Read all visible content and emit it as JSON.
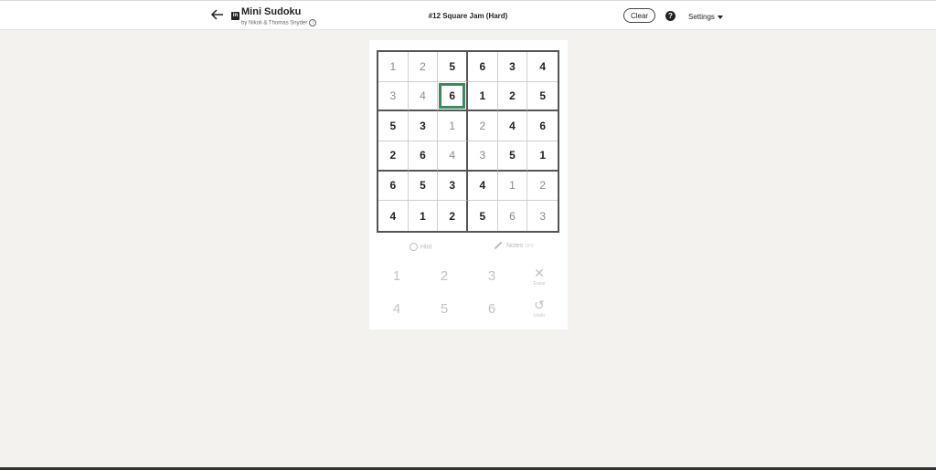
{
  "header": {
    "app_title": "Mini Sudoku",
    "byline": "by Nikoli & Thomas Snyder",
    "linkedin_badge": "in",
    "puzzle_title": "#12 Square Jam (Hard)",
    "clear_label": "Clear",
    "help_label": "?",
    "settings_label": "Settings"
  },
  "board": {
    "rows": [
      [
        {
          "v": "1",
          "t": "entered"
        },
        {
          "v": "2",
          "t": "entered"
        },
        {
          "v": "5",
          "t": "given"
        },
        {
          "v": "6",
          "t": "given"
        },
        {
          "v": "3",
          "t": "given"
        },
        {
          "v": "4",
          "t": "given"
        }
      ],
      [
        {
          "v": "3",
          "t": "entered"
        },
        {
          "v": "4",
          "t": "entered"
        },
        {
          "v": "6",
          "t": "given",
          "selected": true
        },
        {
          "v": "1",
          "t": "given"
        },
        {
          "v": "2",
          "t": "given"
        },
        {
          "v": "5",
          "t": "given"
        }
      ],
      [
        {
          "v": "5",
          "t": "given"
        },
        {
          "v": "3",
          "t": "given"
        },
        {
          "v": "1",
          "t": "entered"
        },
        {
          "v": "2",
          "t": "entered"
        },
        {
          "v": "4",
          "t": "given"
        },
        {
          "v": "6",
          "t": "given"
        }
      ],
      [
        {
          "v": "2",
          "t": "given"
        },
        {
          "v": "6",
          "t": "given"
        },
        {
          "v": "4",
          "t": "entered"
        },
        {
          "v": "3",
          "t": "entered"
        },
        {
          "v": "5",
          "t": "given"
        },
        {
          "v": "1",
          "t": "given"
        }
      ],
      [
        {
          "v": "6",
          "t": "given"
        },
        {
          "v": "5",
          "t": "given"
        },
        {
          "v": "3",
          "t": "given"
        },
        {
          "v": "4",
          "t": "given"
        },
        {
          "v": "1",
          "t": "entered"
        },
        {
          "v": "2",
          "t": "entered"
        }
      ],
      [
        {
          "v": "4",
          "t": "given"
        },
        {
          "v": "1",
          "t": "given"
        },
        {
          "v": "2",
          "t": "given"
        },
        {
          "v": "5",
          "t": "given"
        },
        {
          "v": "6",
          "t": "entered"
        },
        {
          "v": "3",
          "t": "entered"
        }
      ]
    ],
    "selected_color": "#3b8a5e"
  },
  "tools": {
    "hint_label": "Hint",
    "notes_label": "Notes",
    "notes_state": "OFF"
  },
  "keypad": {
    "keys": [
      "1",
      "2",
      "3",
      "4",
      "5",
      "6"
    ],
    "erase_label": "Erase",
    "undo_label": "Undo"
  }
}
